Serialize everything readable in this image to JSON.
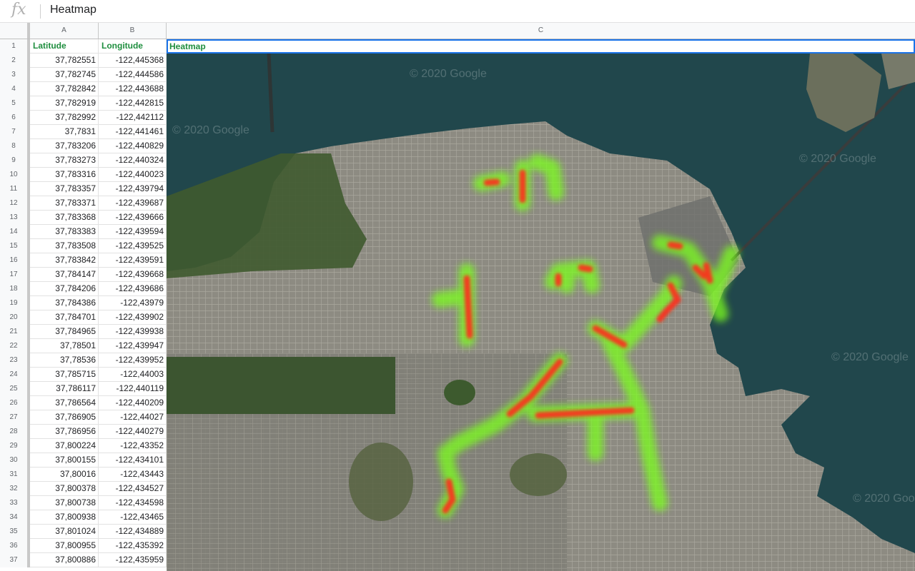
{
  "formula_bar": {
    "icon": "fx",
    "value": "Heatmap"
  },
  "columns": [
    "A",
    "B",
    "C"
  ],
  "header_row": {
    "row": "1",
    "a": "Latitude",
    "b": "Longitude",
    "c": "Heatmap"
  },
  "rows": [
    {
      "n": "2",
      "lat": "37,782551",
      "lng": "-122,445368"
    },
    {
      "n": "3",
      "lat": "37,782745",
      "lng": "-122,444586"
    },
    {
      "n": "4",
      "lat": "37,782842",
      "lng": "-122,443688"
    },
    {
      "n": "5",
      "lat": "37,782919",
      "lng": "-122,442815"
    },
    {
      "n": "6",
      "lat": "37,782992",
      "lng": "-122,442112"
    },
    {
      "n": "7",
      "lat": "37,7831",
      "lng": "-122,441461"
    },
    {
      "n": "8",
      "lat": "37,783206",
      "lng": "-122,440829"
    },
    {
      "n": "9",
      "lat": "37,783273",
      "lng": "-122,440324"
    },
    {
      "n": "10",
      "lat": "37,783316",
      "lng": "-122,440023"
    },
    {
      "n": "11",
      "lat": "37,783357",
      "lng": "-122,439794"
    },
    {
      "n": "12",
      "lat": "37,783371",
      "lng": "-122,439687"
    },
    {
      "n": "13",
      "lat": "37,783368",
      "lng": "-122,439666"
    },
    {
      "n": "14",
      "lat": "37,783383",
      "lng": "-122,439594"
    },
    {
      "n": "15",
      "lat": "37,783508",
      "lng": "-122,439525"
    },
    {
      "n": "16",
      "lat": "37,783842",
      "lng": "-122,439591"
    },
    {
      "n": "17",
      "lat": "37,784147",
      "lng": "-122,439668"
    },
    {
      "n": "18",
      "lat": "37,784206",
      "lng": "-122,439686"
    },
    {
      "n": "19",
      "lat": "37,784386",
      "lng": "-122,43979"
    },
    {
      "n": "20",
      "lat": "37,784701",
      "lng": "-122,439902"
    },
    {
      "n": "21",
      "lat": "37,784965",
      "lng": "-122,439938"
    },
    {
      "n": "22",
      "lat": "37,78501",
      "lng": "-122,439947"
    },
    {
      "n": "23",
      "lat": "37,78536",
      "lng": "-122,439952"
    },
    {
      "n": "24",
      "lat": "37,785715",
      "lng": "-122,44003"
    },
    {
      "n": "25",
      "lat": "37,786117",
      "lng": "-122,440119"
    },
    {
      "n": "26",
      "lat": "37,786564",
      "lng": "-122,440209"
    },
    {
      "n": "27",
      "lat": "37,786905",
      "lng": "-122,44027"
    },
    {
      "n": "28",
      "lat": "37,786956",
      "lng": "-122,440279"
    },
    {
      "n": "29",
      "lat": "37,800224",
      "lng": "-122,43352"
    },
    {
      "n": "30",
      "lat": "37,800155",
      "lng": "-122,434101"
    },
    {
      "n": "31",
      "lat": "37,80016",
      "lng": "-122,43443"
    },
    {
      "n": "32",
      "lat": "37,800378",
      "lng": "-122,434527"
    },
    {
      "n": "33",
      "lat": "37,800738",
      "lng": "-122,434598"
    },
    {
      "n": "34",
      "lat": "37,800938",
      "lng": "-122,43465"
    },
    {
      "n": "35",
      "lat": "37,801024",
      "lng": "-122,434889"
    },
    {
      "n": "36",
      "lat": "37,800955",
      "lng": "-122,435392"
    },
    {
      "n": "37",
      "lat": "37,800886",
      "lng": "-122,435959"
    }
  ],
  "map": {
    "watermark": "© 2020 Google",
    "colors": {
      "water": "#1f4a4f",
      "land": "#8a8a80",
      "park": "#3e5a2e",
      "heat_low": "#7cff1a",
      "heat_high": "#ff1e1e"
    }
  }
}
